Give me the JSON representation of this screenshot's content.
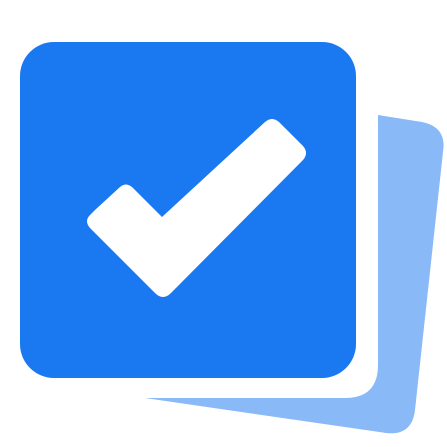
{
  "app_icon": {
    "icon": "checkbox-stack-icon",
    "colors": {
      "front_card": "#1a78f0",
      "back_card": "#8ab9f7",
      "checkmark": "#ffffff",
      "background": "#ffffff"
    }
  }
}
